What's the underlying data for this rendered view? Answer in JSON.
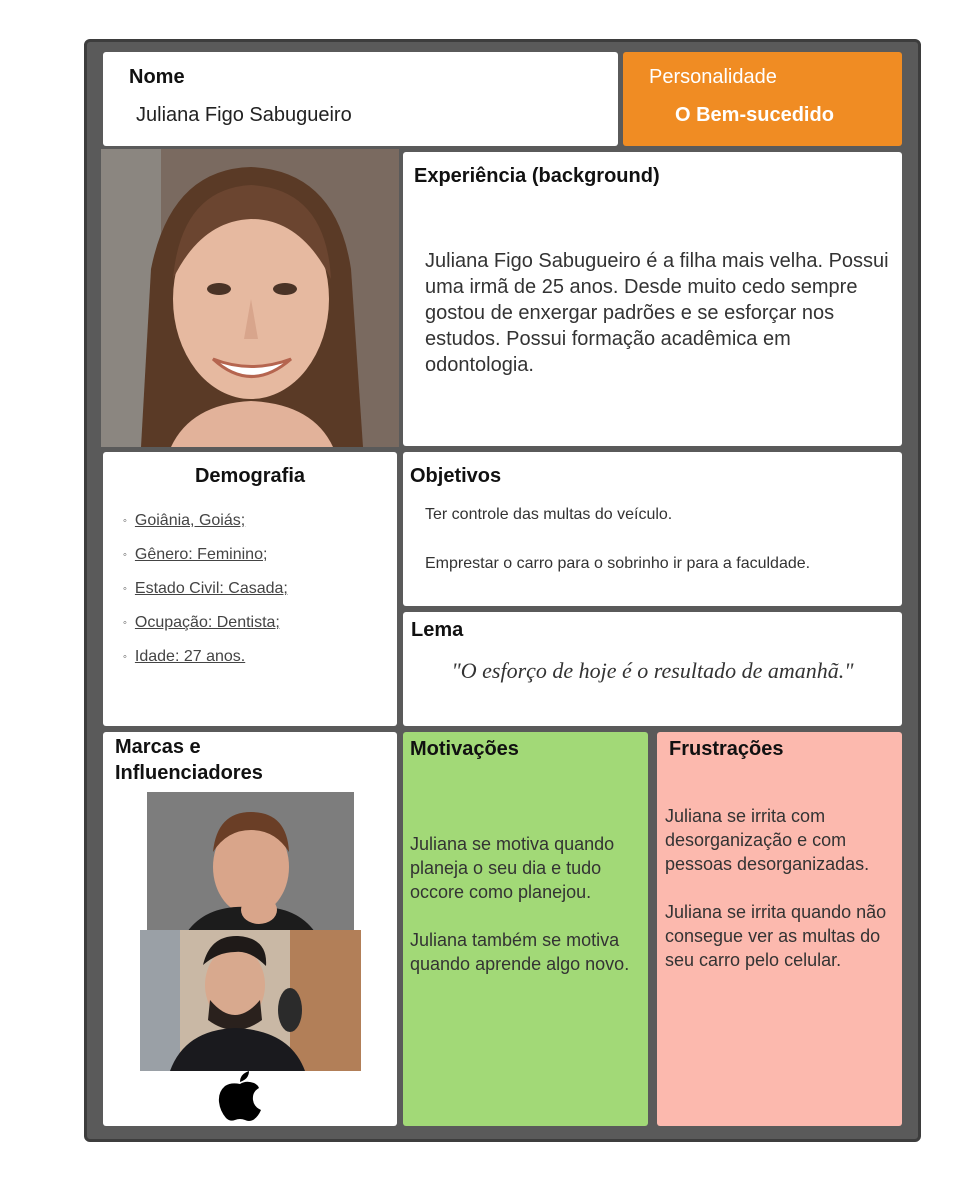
{
  "nome": {
    "label": "Nome",
    "value": "Juliana Figo Sabugueiro"
  },
  "personalidade": {
    "label": "Personalidade",
    "value": "O Bem-sucedido",
    "color": "#f08c23"
  },
  "experiencia": {
    "title": "Experiência (background)",
    "text": "Juliana Figo Sabugueiro é a filha mais velha. Possui uma irmã de 25 anos. Desde muito cedo sempre gostou de enxergar padrões e se esforçar nos estudos. Possui formação acadêmica em odontologia."
  },
  "demografia": {
    "title": "Demografia",
    "items": [
      "Goiânia, Goiás;",
      "Gênero: Feminino;",
      "Estado Civil: Casada;",
      "Ocupação: Dentista;",
      "Idade: 27 anos."
    ]
  },
  "objetivos": {
    "title": "Objetivos",
    "items": [
      "Ter controle das multas do veículo.",
      "Emprestar o carro para o sobrinho ir para a faculdade."
    ]
  },
  "lema": {
    "title": "Lema",
    "quote": "\"O esforço de hoje é o resultado de amanhã.\""
  },
  "marcas": {
    "title": "Marcas e Influenciadores",
    "logo_icon": "apple-logo-icon"
  },
  "motivacoes": {
    "title": "Motivações",
    "text": "Juliana se motiva quando planeja o seu dia e tudo occore como planejou.\n\nJuliana também se motiva quando aprende algo novo.",
    "color": "#a2d977"
  },
  "frustracoes": {
    "title": "Frustrações",
    "text": "Juliana se irrita com desorganização e com pessoas desorganizadas.\n\nJuliana se irrita quando não consegue ver as multas do seu carro pelo celular.",
    "color": "#fcb9ae"
  }
}
